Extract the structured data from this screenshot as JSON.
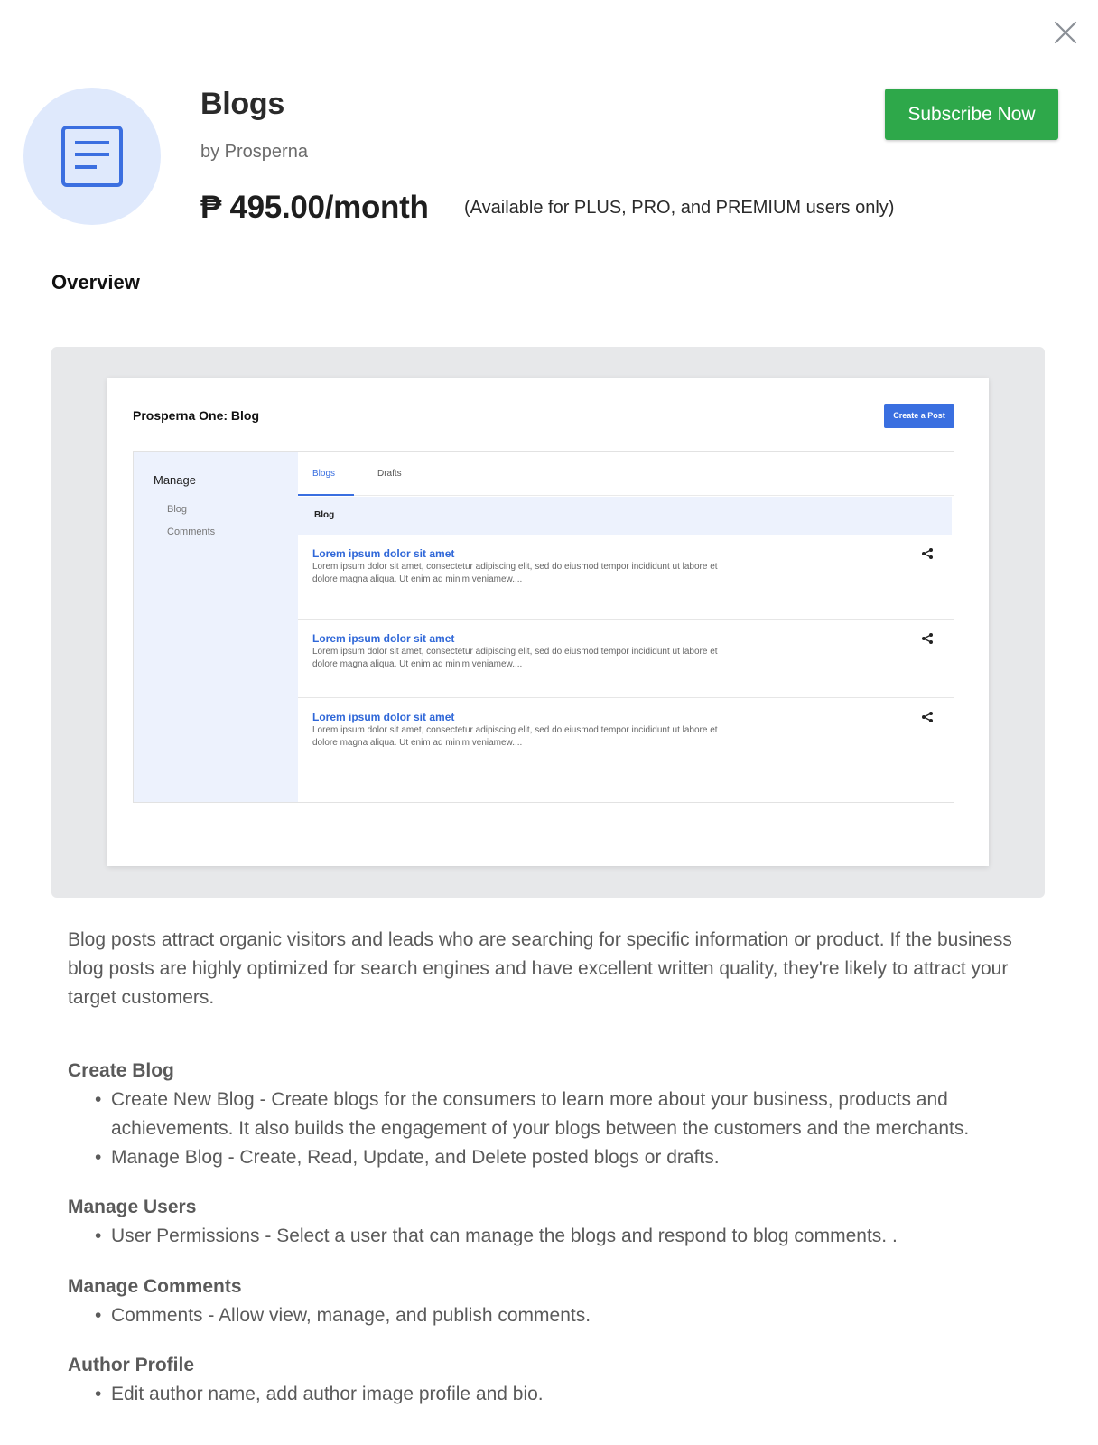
{
  "header": {
    "title": "Blogs",
    "by": "by Prosperna",
    "price": "₱ 495.00/month",
    "availability": "(Available for PLUS, PRO, and PREMIUM users only)",
    "subscribe_label": "Subscribe Now",
    "icon": "document-icon",
    "close_icon": "close-icon"
  },
  "tabs": {
    "overview": "Overview"
  },
  "preview": {
    "title": "Prosperna One: Blog",
    "create_button": "Create a Post",
    "sidebar": {
      "heading": "Manage",
      "items": [
        "Blog",
        "Comments"
      ]
    },
    "tabs": [
      "Blogs",
      "Drafts"
    ],
    "list_header": "Blog",
    "posts": [
      {
        "title": "Lorem ipsum dolor sit amet",
        "line1": "Lorem ipsum dolor sit amet, consectetur adipiscing elit, sed do eiusmod tempor incididunt ut labore et",
        "line2": "dolore magna aliqua. Ut enim ad minim veniamew...."
      },
      {
        "title": "Lorem ipsum dolor sit amet",
        "line1": "Lorem ipsum dolor sit amet, consectetur adipiscing elit, sed do eiusmod tempor incididunt ut labore et",
        "line2": "dolore magna aliqua. Ut enim ad minim veniamew...."
      },
      {
        "title": "Lorem ipsum dolor sit amet",
        "line1": "Lorem ipsum dolor sit amet, consectetur adipiscing elit, sed do eiusmod tempor incididunt ut labore et",
        "line2": "dolore magna aliqua. Ut enim ad minim veniamew...."
      }
    ],
    "share_icon": "share-icon"
  },
  "description": "Blog posts attract organic visitors and leads who are searching for specific information or product. If the business blog posts are highly optimized for search engines and have excellent written quality, they're likely to attract your target customers.",
  "features": [
    {
      "heading": "Create Blog",
      "items": [
        "Create New Blog - Create blogs for the consumers to learn more about your business, products and achievements. It also builds the engagement of your blogs between the customers and the merchants.",
        "Manage Blog - Create, Read, Update, and Delete posted blogs or drafts."
      ]
    },
    {
      "heading": "Manage Users",
      "items": [
        "User Permissions - Select a user that can manage the blogs and respond to blog comments. ."
      ]
    },
    {
      "heading": "Manage Comments",
      "items": [
        "Comments - Allow view, manage, and publish comments."
      ]
    },
    {
      "heading": "Author Profile",
      "items": [
        "Edit author name, add author image profile and bio."
      ]
    }
  ],
  "colors": {
    "accent_green": "#2ea84a",
    "accent_blue": "#3a6fe0",
    "icon_bg": "#dfe9fc"
  }
}
